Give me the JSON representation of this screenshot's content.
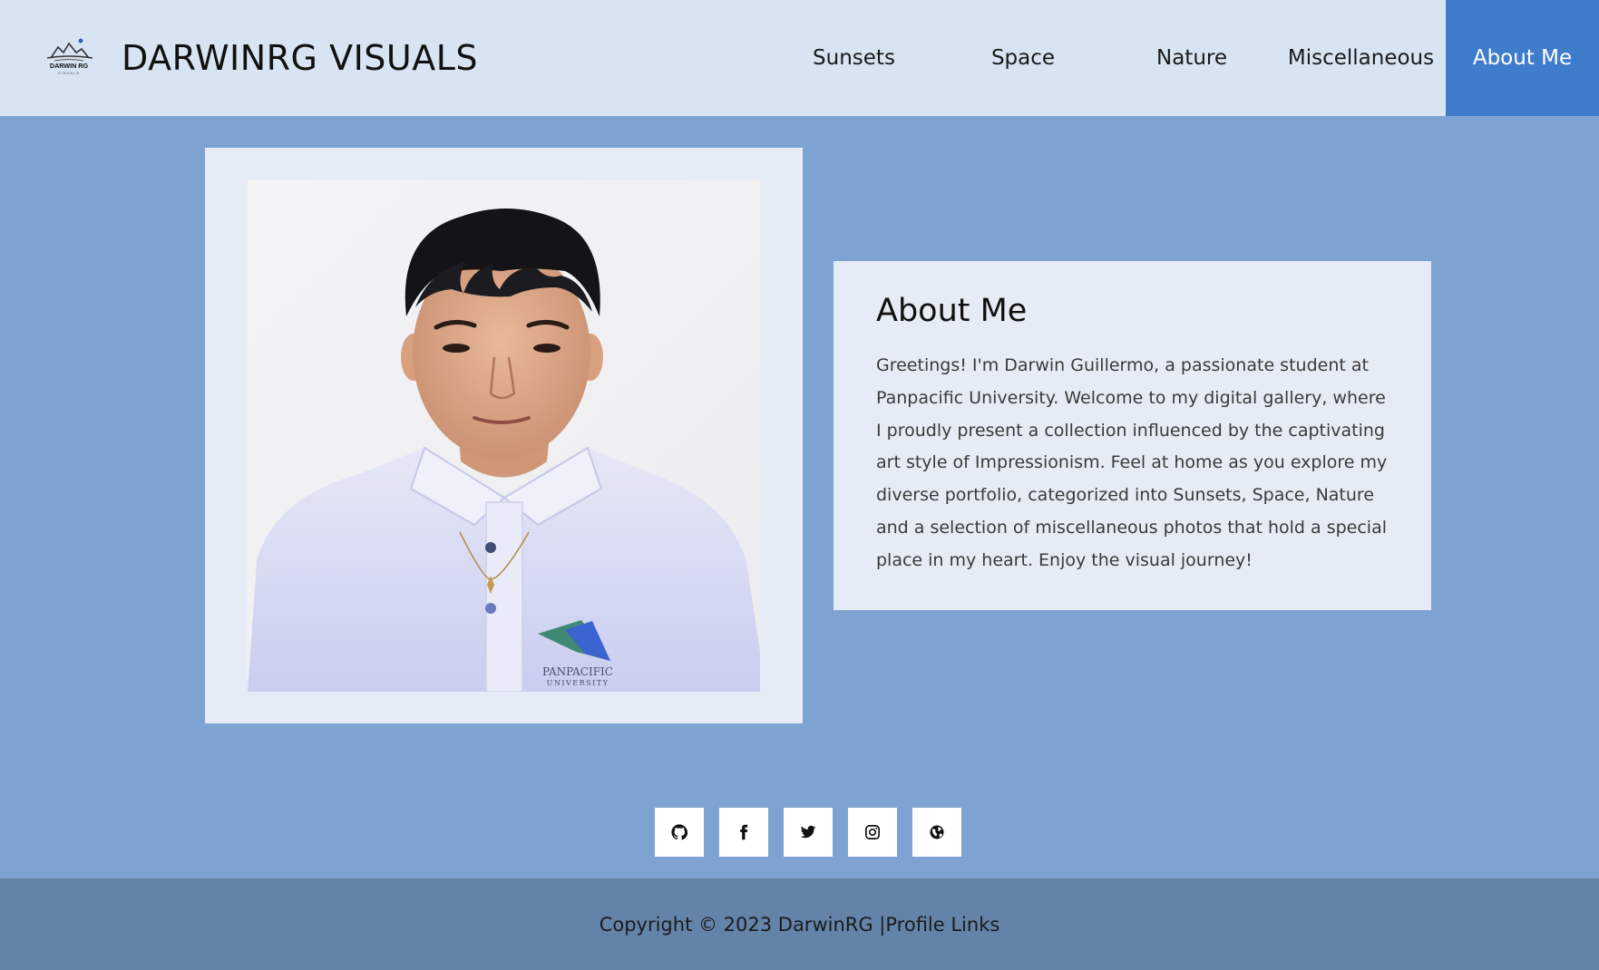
{
  "header": {
    "brand": "DARWINRG VISUALS",
    "logo_icon": "darwinrg-logo-icon",
    "logo_text": "DARWIN RG",
    "logo_subtext": "VISUALS",
    "nav": [
      {
        "label": "Sunsets"
      },
      {
        "label": "Space"
      },
      {
        "label": "Nature"
      },
      {
        "label": "Miscellaneous"
      },
      {
        "label": "About Me",
        "active": true
      }
    ]
  },
  "about": {
    "photo_alt": "Portrait of Darwin Guillermo",
    "shirt_logo_text": "PANPACIFIC",
    "shirt_logo_subtext": "UNIVERSITY",
    "title": "About Me",
    "text": "Greetings! I'm Darwin Guillermo, a passionate student at Panpacific University. Welcome to my digital gallery, where I proudly present a collection influenced by the captivating art style of Impressionism. Feel at home as you explore my diverse portfolio, categorized into Sunsets, Space, Nature and a selection of miscellaneous photos that hold a special place in my heart. Enjoy the visual journey!"
  },
  "social": [
    {
      "icon": "github-icon"
    },
    {
      "icon": "facebook-icon"
    },
    {
      "icon": "twitter-icon"
    },
    {
      "icon": "instagram-icon"
    },
    {
      "icon": "globe-icon"
    }
  ],
  "footer": {
    "copyright": "Copyright © 2023 DarwinRG |",
    "link": "Profile Links"
  },
  "colors": {
    "header_bg": "#d8e4f2",
    "page_bg": "#7ea3d3",
    "active_nav": "#3f7ccc",
    "card_bg": "#e6ecf6",
    "footer_bg": "#6483a9"
  }
}
